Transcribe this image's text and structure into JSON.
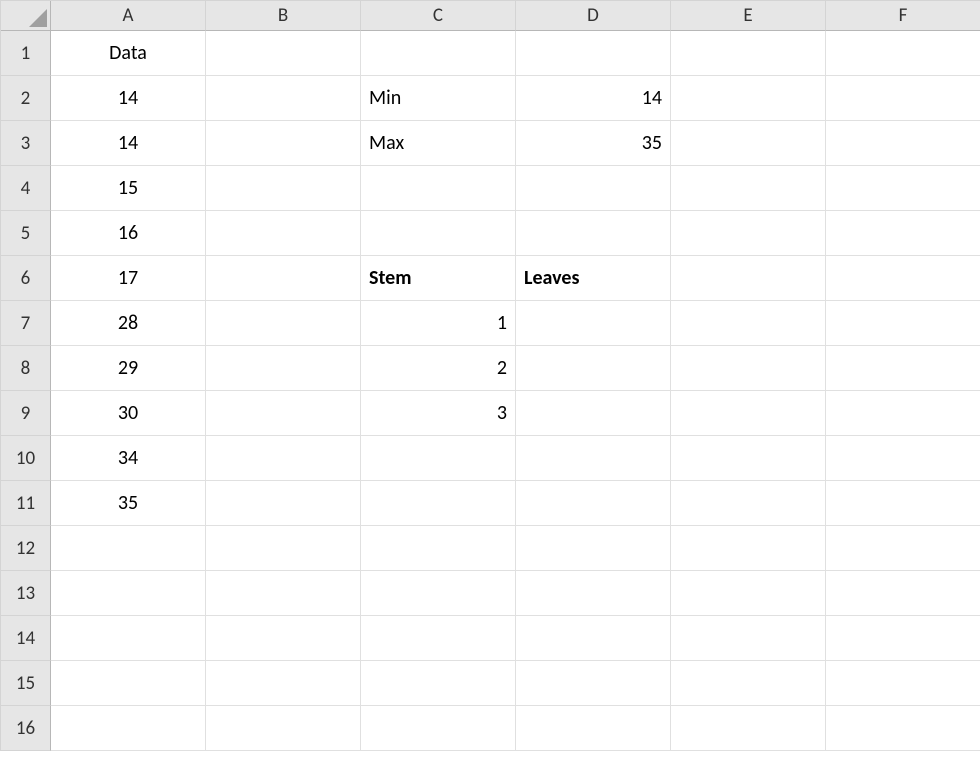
{
  "columns": [
    "A",
    "B",
    "C",
    "D",
    "E",
    "F"
  ],
  "rows": [
    "1",
    "2",
    "3",
    "4",
    "5",
    "6",
    "7",
    "8",
    "9",
    "10",
    "11",
    "12",
    "13",
    "14",
    "15",
    "16"
  ],
  "cells": {
    "A1": {
      "value": "Data",
      "align": "center"
    },
    "A2": {
      "value": "14",
      "align": "center"
    },
    "A3": {
      "value": "14",
      "align": "center"
    },
    "A4": {
      "value": "15",
      "align": "center"
    },
    "A5": {
      "value": "16",
      "align": "center"
    },
    "A6": {
      "value": "17",
      "align": "center"
    },
    "A7": {
      "value": "28",
      "align": "center"
    },
    "A8": {
      "value": "29",
      "align": "center"
    },
    "A9": {
      "value": "30",
      "align": "center"
    },
    "A10": {
      "value": "34",
      "align": "center"
    },
    "A11": {
      "value": "35",
      "align": "center"
    },
    "C2": {
      "value": "Min",
      "align": "left"
    },
    "C3": {
      "value": "Max",
      "align": "left"
    },
    "D2": {
      "value": "14",
      "align": "right"
    },
    "D3": {
      "value": "35",
      "align": "right"
    },
    "C6": {
      "value": "Stem",
      "align": "left",
      "bold": true
    },
    "D6": {
      "value": "Leaves",
      "align": "left",
      "bold": true
    },
    "C7": {
      "value": "1",
      "align": "right"
    },
    "C8": {
      "value": "2",
      "align": "right"
    },
    "C9": {
      "value": "3",
      "align": "right"
    }
  }
}
